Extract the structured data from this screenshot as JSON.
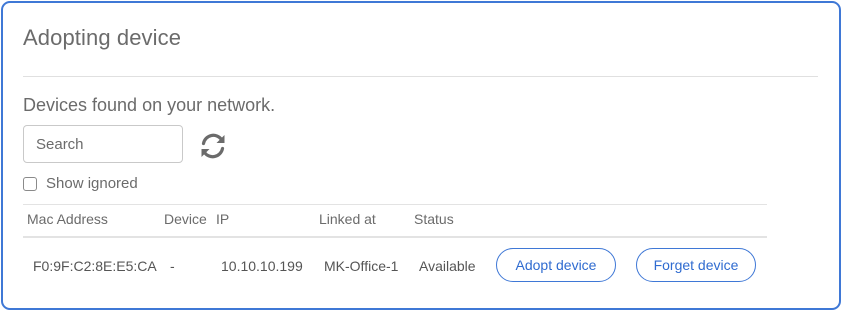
{
  "dialog": {
    "title": "Adopting device",
    "subtitle": "Devices found on your network."
  },
  "search": {
    "placeholder": "Search",
    "value": ""
  },
  "refresh": {
    "icon": "refresh-icon"
  },
  "filter": {
    "show_ignored_label": "Show ignored",
    "show_ignored_checked": false
  },
  "table": {
    "columns": [
      "Mac Address",
      "Device",
      "IP",
      "Linked at",
      "Status"
    ],
    "rows": [
      {
        "mac": "F0:9F:C2:8E:E5:CA",
        "device": "-",
        "ip": "10.10.10.199",
        "linked_at": "MK-Office-1",
        "status": "Available",
        "adopt_label": "Adopt device",
        "forget_label": "Forget device"
      }
    ]
  },
  "colors": {
    "accent": "#3f78d6",
    "text": "#6b6b6b"
  }
}
